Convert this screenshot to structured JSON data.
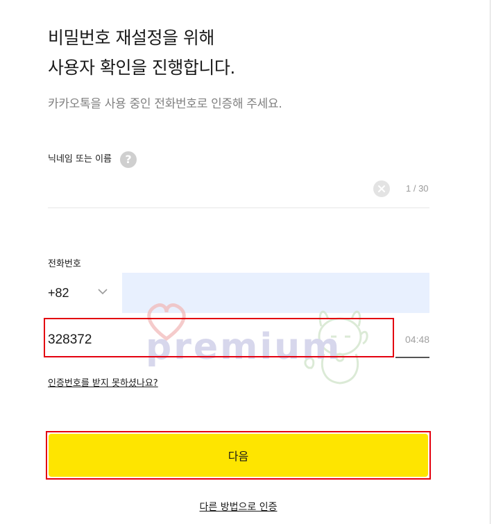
{
  "header": {
    "title_line1": "비밀번호 재설정을 위해",
    "title_line2": "사용자 확인을 진행합니다.",
    "subtitle": "카카오톡을 사용 중인 전화번호로 인증해 주세요."
  },
  "nickname": {
    "label": "닉네임 또는 이름",
    "help_icon": "question-icon",
    "value": "",
    "char_count": "1 / 30"
  },
  "phone": {
    "label": "전화번호",
    "country_code": "+82",
    "value": ""
  },
  "verification": {
    "code_value": "328372",
    "timer": "04:48",
    "resend_link": "인증번호를 받지 못하셨나요?"
  },
  "actions": {
    "next_label": "다음",
    "other_method_link": "다른 방법으로 인증"
  },
  "watermark": {
    "text": "premium"
  },
  "colors": {
    "accent_yellow": "#fee500",
    "highlight_red": "#e3000f",
    "autofill_blue": "#e8f0fe",
    "muted_text": "#808080"
  }
}
